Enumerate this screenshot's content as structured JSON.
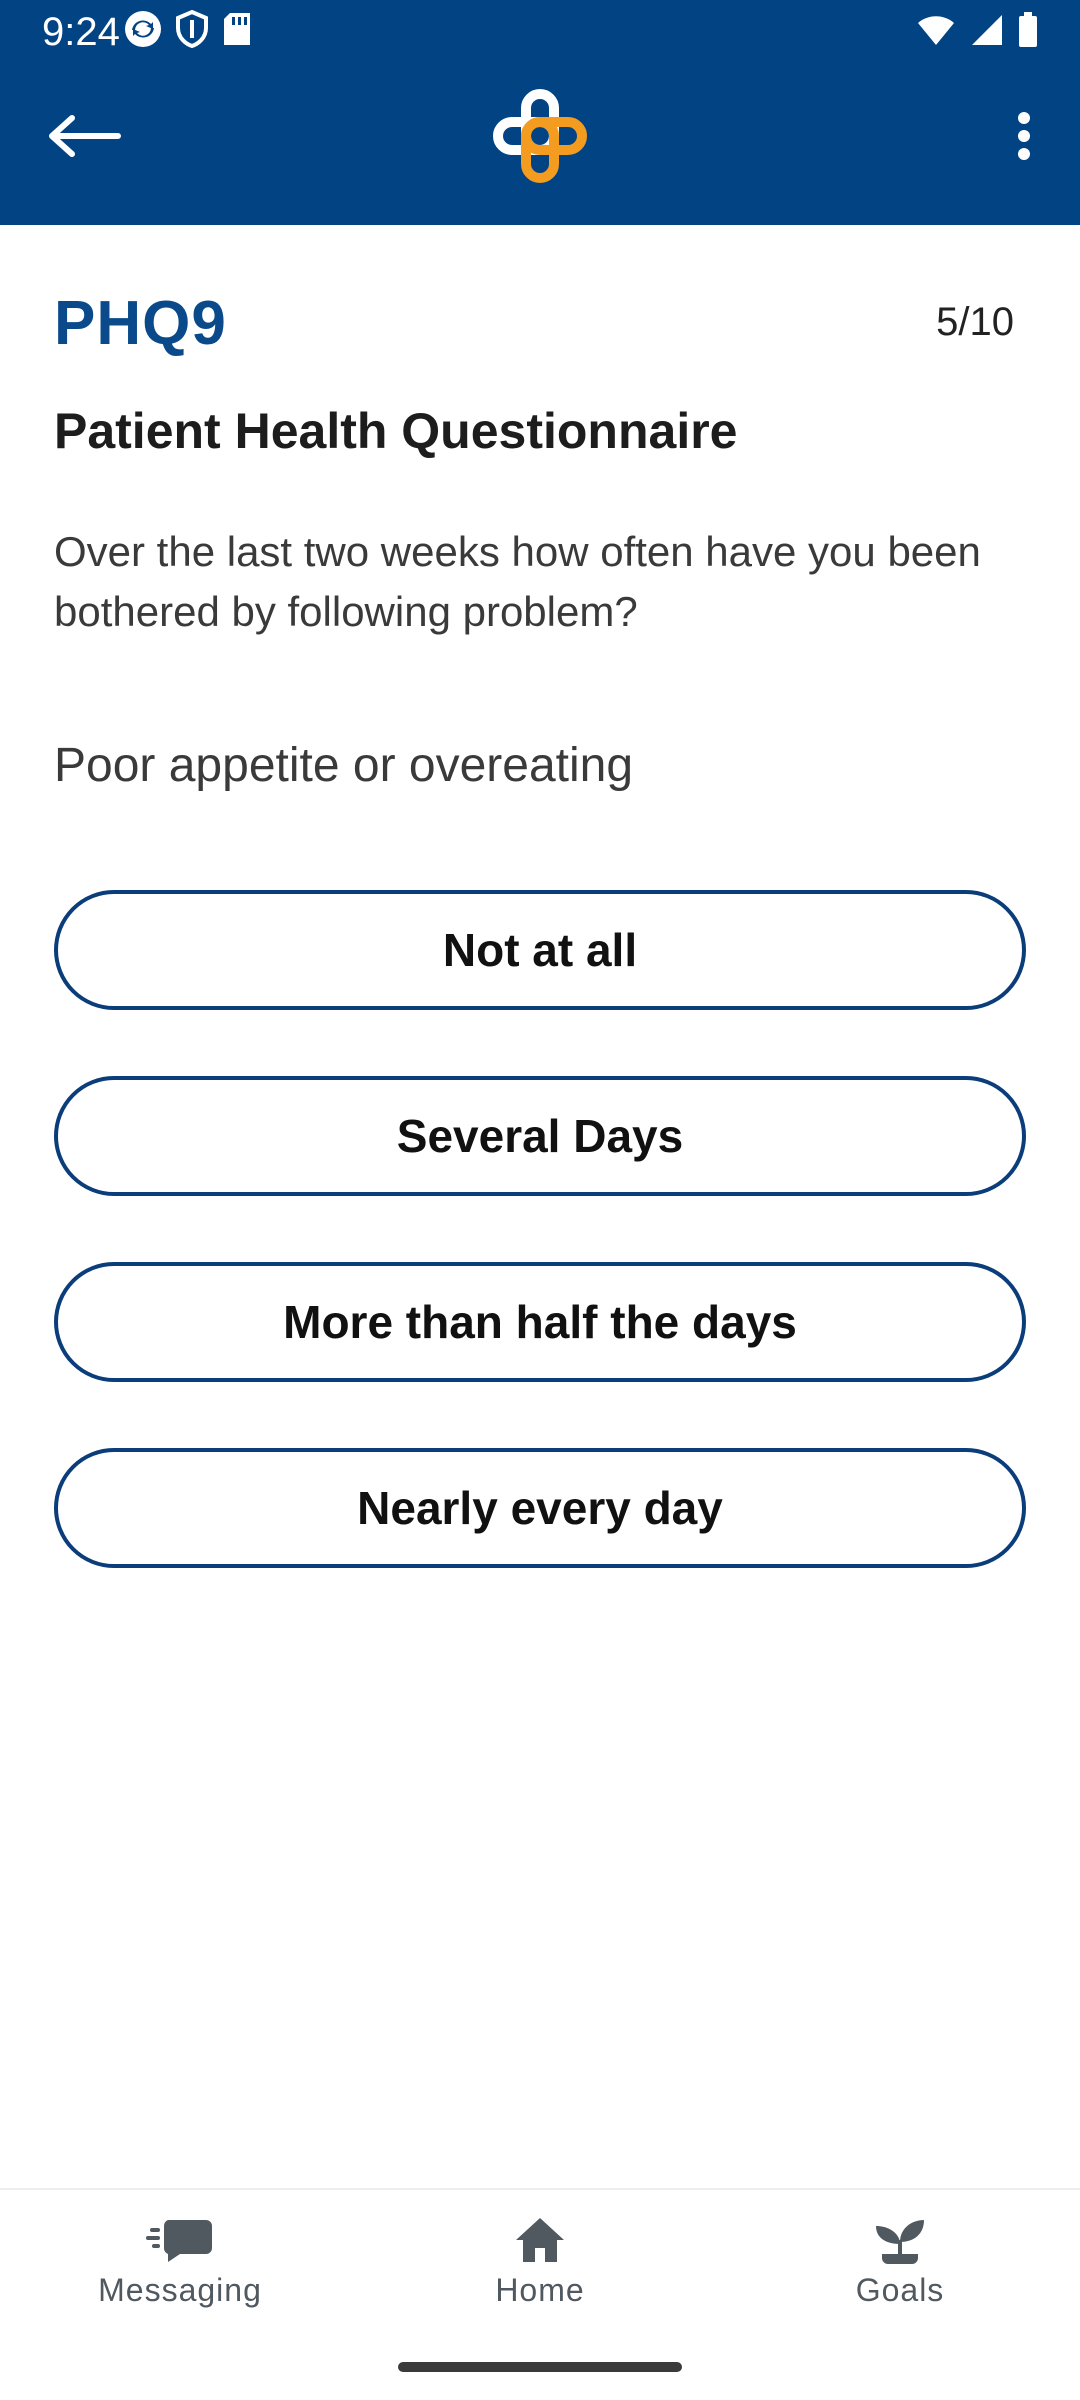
{
  "status_bar": {
    "time": "9:24",
    "left_icons": [
      "sync-icon",
      "shield-icon",
      "sd-card-icon"
    ],
    "right_icons": [
      "wifi-icon",
      "signal-icon",
      "battery-icon"
    ]
  },
  "app_bar": {
    "back_icon": "arrow-left-icon",
    "logo_icon": "health-cross-logo",
    "menu_icon": "more-vert-icon",
    "colors": {
      "background": "#024384",
      "logo_white": "#ffffff",
      "logo_orange": "#f39c1f"
    }
  },
  "questionnaire": {
    "code": "PHQ9",
    "progress": "5/10",
    "title": "Patient Health Questionnaire",
    "instruction": "Over the last two weeks how often have you been bothered by following problem?",
    "question": "Poor appetite or overeating",
    "options": [
      {
        "label": "Not at all"
      },
      {
        "label": "Several Days"
      },
      {
        "label": "More than half the days"
      },
      {
        "label": "Nearly every day"
      }
    ]
  },
  "bottom_nav": {
    "items": [
      {
        "label": "Messaging",
        "icon": "chat-icon"
      },
      {
        "label": "Home",
        "icon": "home-icon"
      },
      {
        "label": "Goals",
        "icon": "sprout-icon"
      }
    ]
  }
}
